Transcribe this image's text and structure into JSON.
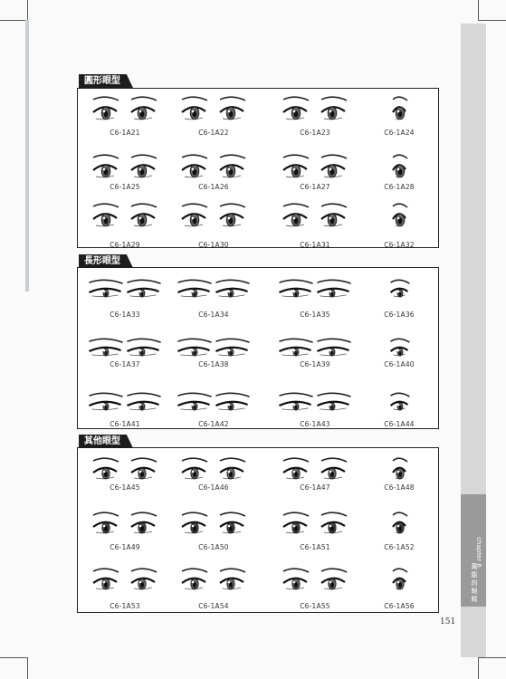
{
  "sections": [
    {
      "title": "圓形眼型",
      "codes": [
        "C6-1A21",
        "C6-1A22",
        "C6-1A23",
        "C6-1A24",
        "C6-1A25",
        "C6-1A26",
        "C6-1A27",
        "C6-1A28",
        "C6-1A29",
        "C6-1A30",
        "C6-1A31",
        "C6-1A32"
      ]
    },
    {
      "title": "長形眼型",
      "codes": [
        "C6-1A33",
        "C6-1A34",
        "C6-1A35",
        "C6-1A36",
        "C6-1A37",
        "C6-1A38",
        "C6-1A39",
        "C6-1A40",
        "C6-1A41",
        "C6-1A42",
        "C6-1A43",
        "C6-1A44"
      ]
    },
    {
      "title": "其他眼型",
      "codes": [
        "C6-1A45",
        "C6-1A46",
        "C6-1A47",
        "C6-1A48",
        "C6-1A49",
        "C6-1A50",
        "C6-1A51",
        "C6-1A52",
        "C6-1A53",
        "C6-1A54",
        "C6-1A55",
        "C6-1A56"
      ]
    }
  ],
  "side_tab": {
    "chapter": "chapter 6",
    "text": "萬 能 的 眼 睛"
  },
  "page_number": "151"
}
